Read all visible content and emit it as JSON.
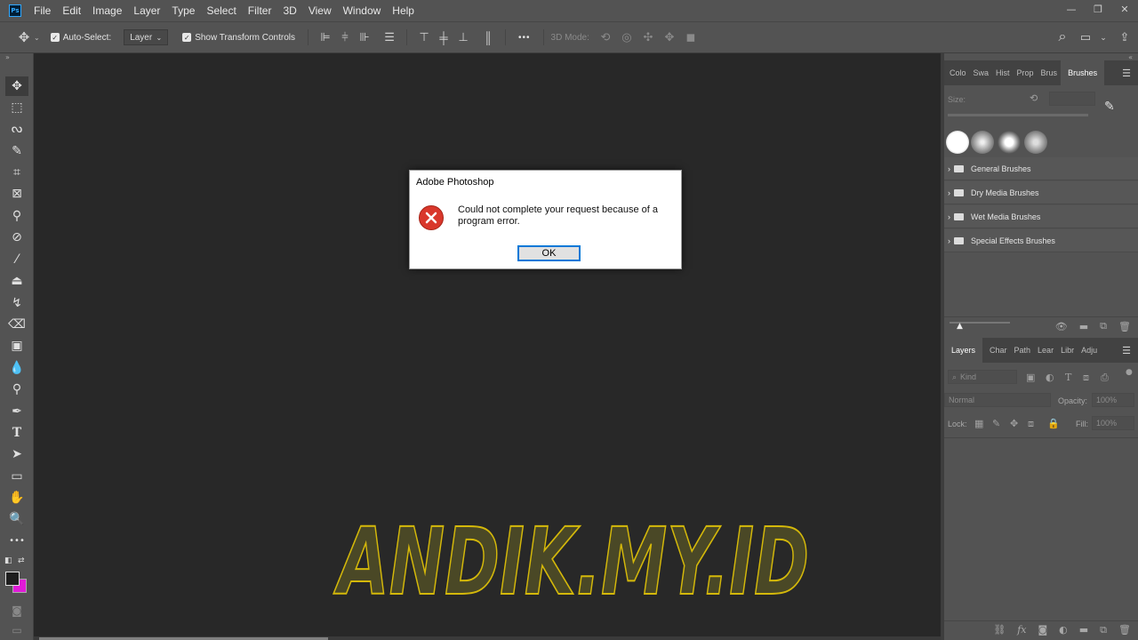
{
  "app": {
    "logo": "Ps"
  },
  "menu": [
    "File",
    "Edit",
    "Image",
    "Layer",
    "Type",
    "Select",
    "Filter",
    "3D",
    "View",
    "Window",
    "Help"
  ],
  "window_controls": {
    "minimize": "—",
    "restore": "❐",
    "close": "✕"
  },
  "options_bar": {
    "move_icon": "✥",
    "auto_select_label": "Auto-Select:",
    "auto_select_value": "Layer",
    "show_transform_label": "Show Transform Controls",
    "more_label": "•••",
    "mode_3d_label": "3D Mode:",
    "search_icon": "⌕"
  },
  "toolbar": {
    "tools": [
      "move-tool",
      "marquee-tool",
      "lasso-tool",
      "quick-select-tool",
      "crop-tool",
      "frame-tool",
      "eyedropper-tool",
      "healing-brush-tool",
      "brush-tool",
      "clone-stamp-tool",
      "history-brush-tool",
      "eraser-tool",
      "gradient-tool",
      "blur-tool",
      "dodge-tool",
      "pen-tool",
      "type-tool",
      "path-select-tool",
      "rectangle-tool",
      "hand-tool",
      "zoom-tool",
      "more-tools"
    ],
    "foreground_color": "#1e1e1e",
    "background_color": "#e01ad8"
  },
  "dialog": {
    "title": "Adobe Photoshop",
    "message": "Could not complete your request because of a program error.",
    "ok_label": "OK"
  },
  "watermark": {
    "text": "ANDIK.MY.ID",
    "fill": "#4a4826",
    "stroke": "#d4b80a"
  },
  "brushes_panel": {
    "tabs": [
      "Colo",
      "Swa",
      "Hist",
      "Prop",
      "Brus",
      "Brushes"
    ],
    "size_label": "Size:",
    "groups": [
      "General Brushes",
      "Dry Media Brushes",
      "Wet Media Brushes",
      "Special Effects Brushes"
    ]
  },
  "layers_panel": {
    "tabs": [
      "Layers",
      "Char",
      "Path",
      "Lear",
      "Libr",
      "Adju"
    ],
    "kind_placeholder": "Kind",
    "blend_mode": "Normal",
    "opacity_label": "Opacity:",
    "opacity_value": "100%",
    "lock_label": "Lock:",
    "fill_label": "Fill:",
    "fill_value": "100%"
  }
}
